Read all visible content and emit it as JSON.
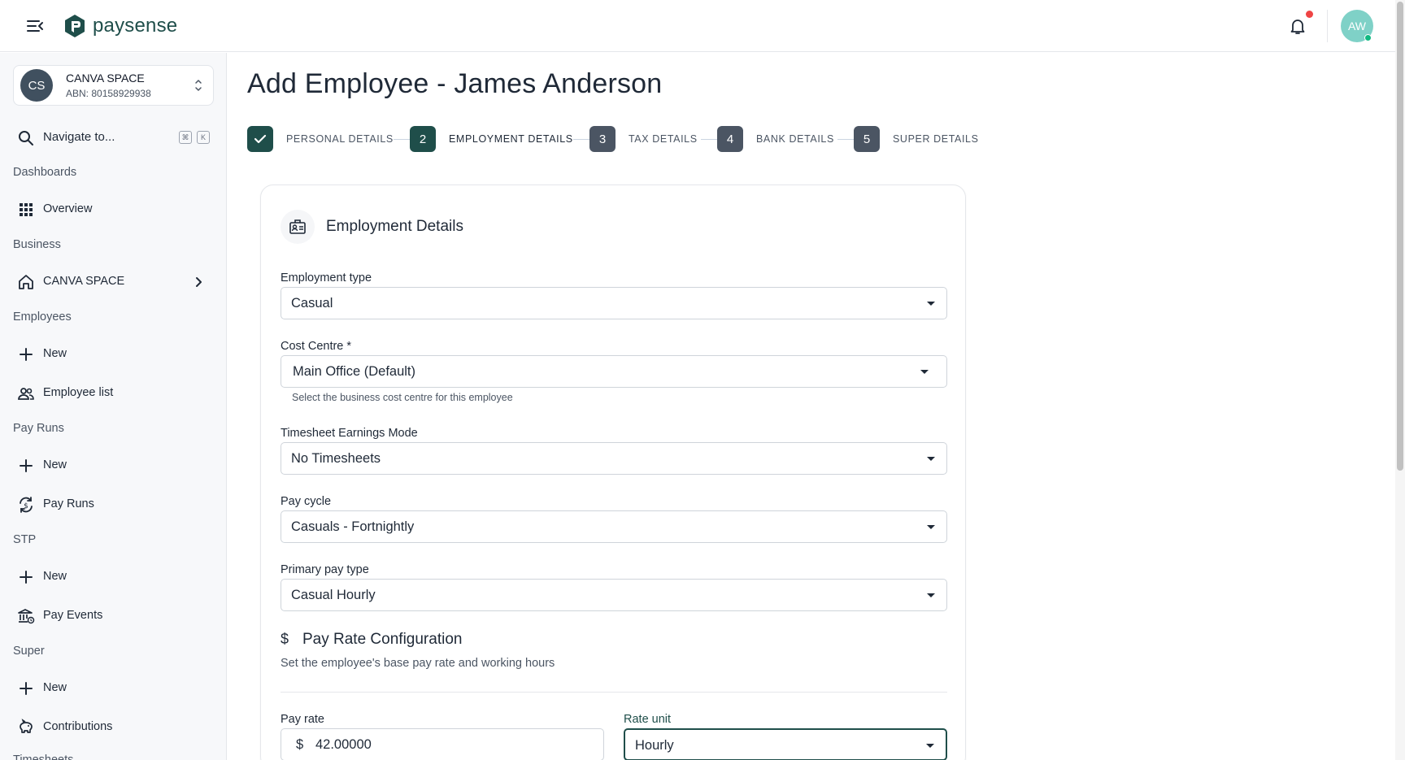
{
  "app": {
    "name": "paysense"
  },
  "header": {
    "avatar_initials": "AW"
  },
  "org": {
    "initials": "CS",
    "name": "CANVA SPACE",
    "abn": "ABN: 80158929938"
  },
  "navigate": {
    "label": "Navigate to...",
    "shortcut_mod": "⌘",
    "shortcut_key": "K"
  },
  "sidebar": {
    "sections": {
      "dashboards": "Dashboards",
      "business": "Business",
      "employees": "Employees",
      "pay_runs": "Pay Runs",
      "stp": "STP",
      "super": "Super",
      "timesheets_partial": "Timesheets"
    },
    "items": {
      "overview": "Overview",
      "canva_space": "CANVA SPACE",
      "employees_new": "New",
      "employee_list": "Employee list",
      "payruns_new": "New",
      "pay_runs": "Pay Runs",
      "stp_new": "New",
      "pay_events": "Pay Events",
      "super_new": "New",
      "contributions": "Contributions"
    }
  },
  "page": {
    "title": "Add Employee - James Anderson"
  },
  "stepper": {
    "steps": [
      {
        "number": "",
        "label": "PERSONAL DETAILS",
        "status": "complete"
      },
      {
        "number": "2",
        "label": "EMPLOYMENT DETAILS",
        "status": "active"
      },
      {
        "number": "3",
        "label": "TAX DETAILS",
        "status": "pending"
      },
      {
        "number": "4",
        "label": "BANK DETAILS",
        "status": "pending"
      },
      {
        "number": "5",
        "label": "SUPER DETAILS",
        "status": "pending"
      }
    ]
  },
  "form": {
    "title": "Employment Details",
    "employment_type": {
      "label": "Employment type",
      "value": "Casual"
    },
    "cost_centre": {
      "label": "Cost Centre *",
      "value": "Main Office (Default)",
      "helper": "Select the business cost centre for this employee"
    },
    "timesheet_mode": {
      "label": "Timesheet Earnings Mode",
      "value": "No Timesheets"
    },
    "pay_cycle": {
      "label": "Pay cycle",
      "value": "Casuals - Fortnightly"
    },
    "primary_pay_type": {
      "label": "Primary pay type",
      "value": "Casual Hourly"
    },
    "pay_rate_config": {
      "icon": "$",
      "title": "Pay Rate Configuration",
      "description": "Set the employee's base pay rate and working hours"
    },
    "pay_rate": {
      "label": "Pay rate",
      "prefix": "$",
      "value": "42.00000"
    },
    "rate_unit": {
      "label": "Rate unit",
      "value": "Hourly"
    }
  },
  "colors": {
    "brand": "#1f4e4a",
    "step_complete": "#1f4e4a",
    "step_active": "#1f4e4a",
    "step_pending": "#4b5563",
    "notification_dot": "#ef4444",
    "avatar_bg": "#7fd1c7"
  }
}
